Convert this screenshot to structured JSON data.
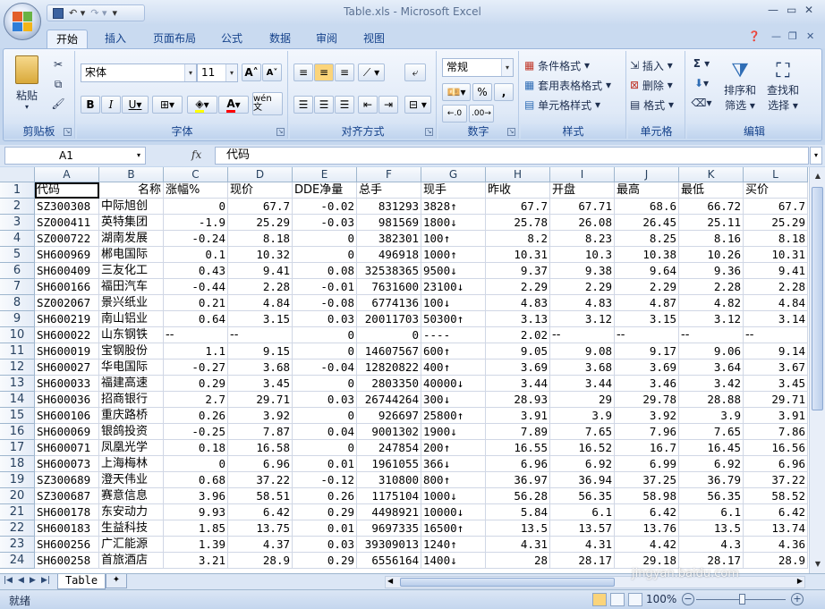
{
  "window": {
    "title": "Table.xls - Microsoft Excel"
  },
  "tabs": [
    "开始",
    "插入",
    "页面布局",
    "公式",
    "数据",
    "审阅",
    "视图"
  ],
  "ribbon": {
    "clipboard": {
      "paste": "粘贴",
      "label": "剪贴板"
    },
    "font": {
      "name": "宋体",
      "size": "11",
      "label": "字体",
      "bold": "B",
      "italic": "I",
      "underline": "U",
      "grow": "A",
      "wen": "wén 文"
    },
    "alignment": {
      "label": "对齐方式"
    },
    "number": {
      "format": "常规",
      "label": "数字",
      "percent": "%",
      "comma": ","
    },
    "styles": {
      "conditional": "条件格式",
      "table": "套用表格格式",
      "cell": "单元格样式",
      "label": "样式"
    },
    "cells": {
      "insert": "插入",
      "delete": "删除",
      "format": "格式",
      "label": "单元格"
    },
    "editing": {
      "sigma": "Σ",
      "sort1": "排序和",
      "sort2": "筛选",
      "find1": "查找和",
      "find2": "选择",
      "label": "编辑"
    }
  },
  "formula_bar": {
    "name_box": "A1",
    "fx": "fx",
    "content": "代码"
  },
  "columns": [
    "A",
    "B",
    "C",
    "D",
    "E",
    "F",
    "G",
    "H",
    "I",
    "J",
    "K",
    "L"
  ],
  "header_row": [
    "代码",
    "名称",
    "涨幅%",
    "现价",
    "DDE净量",
    "总手",
    "现手",
    "昨收",
    "开盘",
    "最高",
    "最低",
    "买价"
  ],
  "rows": [
    [
      "SZ300308",
      "中际旭创",
      "0",
      "67.7",
      "-0.02",
      "831293",
      "3828↑",
      "67.7",
      "67.71",
      "68.6",
      "66.72",
      "67.7"
    ],
    [
      "SZ000411",
      "英特集团",
      "-1.9",
      "25.29",
      "-0.03",
      "981569",
      "1800↓",
      "25.78",
      "26.08",
      "26.45",
      "25.11",
      "25.29"
    ],
    [
      "SZ000722",
      "湖南发展",
      "-0.24",
      "8.18",
      "0",
      "382301",
      "100↑",
      "8.2",
      "8.23",
      "8.25",
      "8.16",
      "8.18"
    ],
    [
      "SH600969",
      "郴电国际",
      "0.1",
      "10.32",
      "0",
      "496918",
      "1000↑",
      "10.31",
      "10.3",
      "10.38",
      "10.26",
      "10.31"
    ],
    [
      "SH600409",
      "三友化工",
      "0.43",
      "9.41",
      "0.08",
      "32538365",
      "9500↓",
      "9.37",
      "9.38",
      "9.64",
      "9.36",
      "9.41"
    ],
    [
      "SH600166",
      "福田汽车",
      "-0.44",
      "2.28",
      "-0.01",
      "7631600",
      "23100↓",
      "2.29",
      "2.29",
      "2.29",
      "2.28",
      "2.28"
    ],
    [
      "SZ002067",
      "景兴纸业",
      "0.21",
      "4.84",
      "-0.08",
      "6774136",
      "100↓",
      "4.83",
      "4.83",
      "4.87",
      "4.82",
      "4.84"
    ],
    [
      "SH600219",
      "南山铝业",
      "0.64",
      "3.15",
      "0.03",
      "20011703",
      "50300↑",
      "3.13",
      "3.12",
      "3.15",
      "3.12",
      "3.14"
    ],
    [
      "SH600022",
      "山东钢铁",
      "--",
      "--",
      "0",
      "0",
      "----",
      "2.02",
      "--",
      "--",
      "--",
      "--"
    ],
    [
      "SH600019",
      "宝钢股份",
      "1.1",
      "9.15",
      "0",
      "14607567",
      "600↑",
      "9.05",
      "9.08",
      "9.17",
      "9.06",
      "9.14"
    ],
    [
      "SH600027",
      "华电国际",
      "-0.27",
      "3.68",
      "-0.04",
      "12820822",
      "400↑",
      "3.69",
      "3.68",
      "3.69",
      "3.64",
      "3.67"
    ],
    [
      "SH600033",
      "福建高速",
      "0.29",
      "3.45",
      "0",
      "2803350",
      "40000↓",
      "3.44",
      "3.44",
      "3.46",
      "3.42",
      "3.45"
    ],
    [
      "SH600036",
      "招商银行",
      "2.7",
      "29.71",
      "0.03",
      "26744264",
      "300↓",
      "28.93",
      "29",
      "29.78",
      "28.88",
      "29.71"
    ],
    [
      "SH600106",
      "重庆路桥",
      "0.26",
      "3.92",
      "0",
      "926697",
      "25800↑",
      "3.91",
      "3.9",
      "3.92",
      "3.9",
      "3.91"
    ],
    [
      "SH600069",
      "银鸽投资",
      "-0.25",
      "7.87",
      "0.04",
      "9001302",
      "1900↓",
      "7.89",
      "7.65",
      "7.96",
      "7.65",
      "7.86"
    ],
    [
      "SH600071",
      "凤凰光学",
      "0.18",
      "16.58",
      "0",
      "247854",
      "200↑",
      "16.55",
      "16.52",
      "16.7",
      "16.45",
      "16.56"
    ],
    [
      "SH600073",
      "上海梅林",
      "0",
      "6.96",
      "0.01",
      "1961055",
      "366↓",
      "6.96",
      "6.92",
      "6.99",
      "6.92",
      "6.96"
    ],
    [
      "SZ300689",
      "澄天伟业",
      "0.68",
      "37.22",
      "-0.12",
      "310800",
      "800↑",
      "36.97",
      "36.94",
      "37.25",
      "36.79",
      "37.22"
    ],
    [
      "SZ300687",
      "赛意信息",
      "3.96",
      "58.51",
      "0.26",
      "1175104",
      "1000↓",
      "56.28",
      "56.35",
      "58.98",
      "56.35",
      "58.52"
    ],
    [
      "SH600178",
      "东安动力",
      "9.93",
      "6.42",
      "0.29",
      "4498921",
      "10000↓",
      "5.84",
      "6.1",
      "6.42",
      "6.1",
      "6.42"
    ],
    [
      "SH600183",
      "生益科技",
      "1.85",
      "13.75",
      "0.01",
      "9697335",
      "16500↑",
      "13.5",
      "13.57",
      "13.76",
      "13.5",
      "13.74"
    ],
    [
      "SH600256",
      "广汇能源",
      "1.39",
      "4.37",
      "0.03",
      "39309013",
      "1240↑",
      "4.31",
      "4.31",
      "4.42",
      "4.3",
      "4.36"
    ],
    [
      "SH600258",
      "首旅酒店",
      "3.21",
      "28.9",
      "0.29",
      "6556164",
      "1400↓",
      "28",
      "28.17",
      "29.18",
      "28.17",
      "28.9"
    ]
  ],
  "sheet_tab": "Table",
  "status": {
    "ready": "就绪",
    "zoom": "100%"
  },
  "watermark": "jingyan.baidu.com",
  "colors": {
    "ribbon_blue": "#c5d7ee",
    "accent": "#15428b",
    "grid": "#d0d7e5"
  }
}
